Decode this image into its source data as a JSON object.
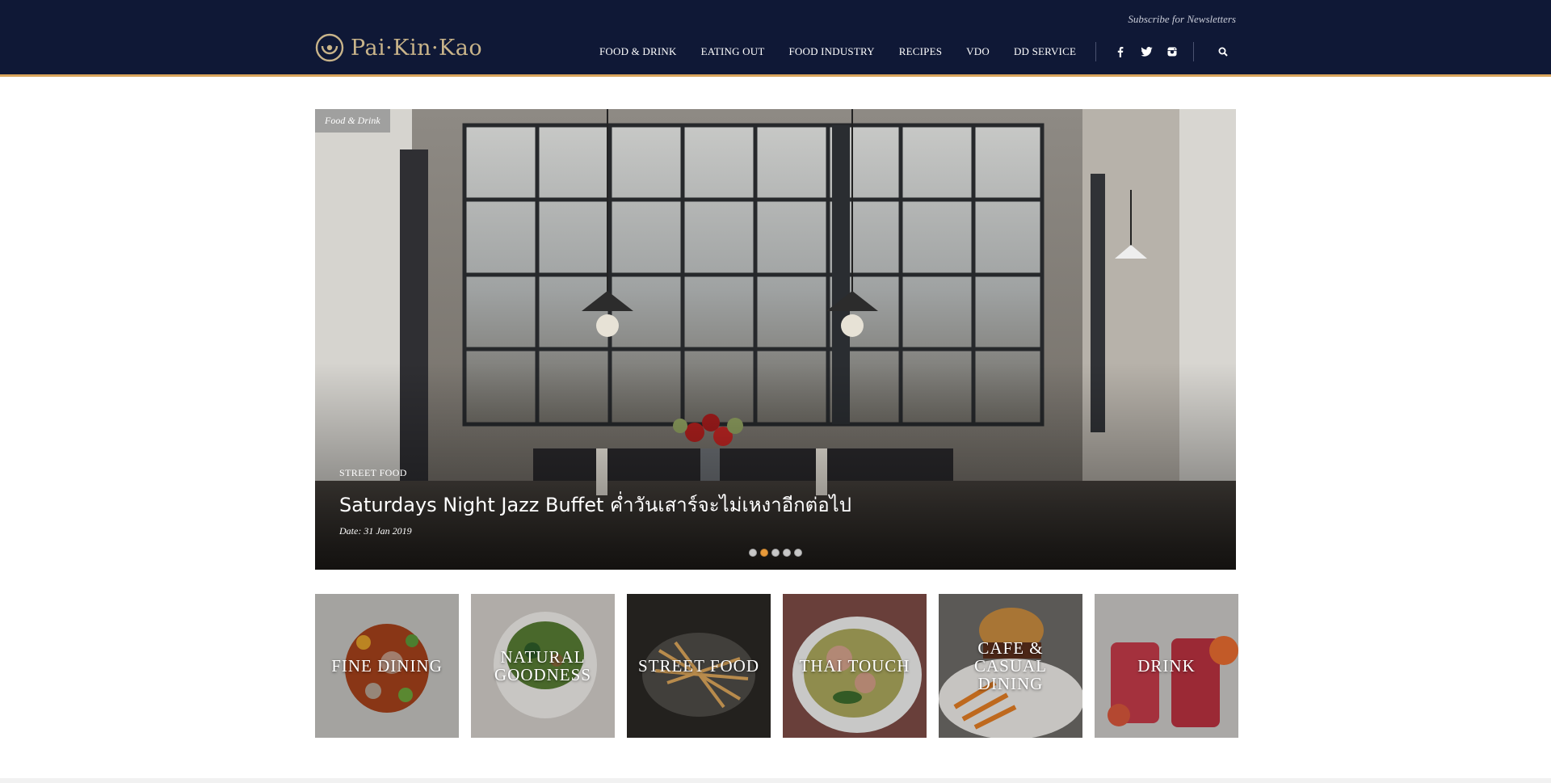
{
  "header": {
    "subscribe": "Subscribe for Newsletters",
    "logo_text": "Pai·Kin·Kao",
    "nav": [
      "FOOD & DRINK",
      "EATING OUT",
      "FOOD INDUSTRY",
      "RECIPES",
      "VDO",
      "DD SERVICE"
    ],
    "social_icons": [
      "facebook-icon",
      "twitter-icon",
      "instagram-icon"
    ],
    "search_icon": "search-icon"
  },
  "hero": {
    "tag": "Food & Drink",
    "category": "STREET FOOD",
    "title": "Saturdays Night Jazz Buffet ค่ำวันเสาร์จะไม่เหงาอีกต่อไป",
    "date": "Date: 31 Jan 2019",
    "slide_count": 5,
    "active_slide": 2
  },
  "categories": [
    {
      "label": "FINE DINING"
    },
    {
      "label": "NATURAL GOODNESS"
    },
    {
      "label": "STREET FOOD"
    },
    {
      "label": "THAI TOUCH"
    },
    {
      "label": "CAFE & CASUAL DINING"
    },
    {
      "label": "DRINK"
    }
  ],
  "colors": {
    "header_bg": "#0f1836",
    "accent": "#d9a55c",
    "logo": "#c9b48a",
    "dot_active": "#e89a3a"
  }
}
